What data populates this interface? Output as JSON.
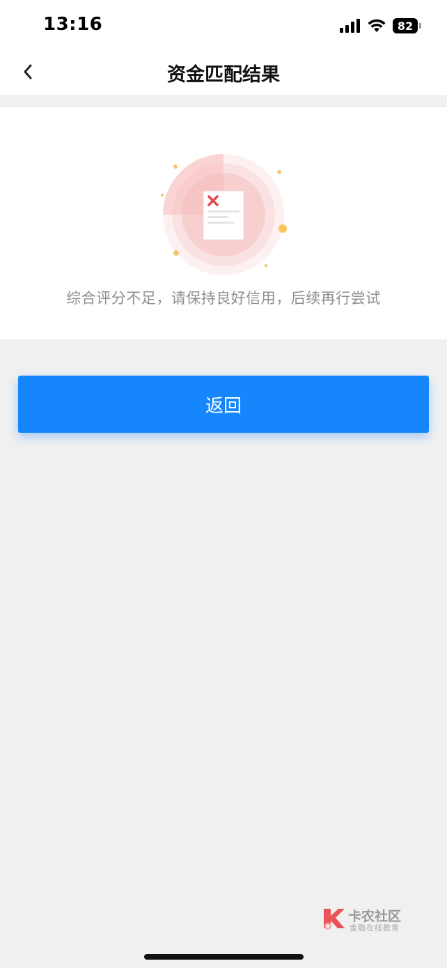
{
  "status_bar": {
    "time": "13:16",
    "battery": "82",
    "icons": [
      "cellular-signal-icon",
      "wifi-icon",
      "battery-icon"
    ]
  },
  "header": {
    "title": "资金匹配结果",
    "back_icon": "chevron-left-icon"
  },
  "result": {
    "illustration_icon": "document-rejected-icon",
    "message": "综合评分不足，请保持良好信用，后续再行尝试"
  },
  "actions": {
    "return_label": "返回"
  },
  "watermark": {
    "name": "卡农社区",
    "subtitle": "金融在线教育"
  },
  "colors": {
    "primary": "#1686fd",
    "page_bg": "#f0f0f0",
    "card_bg": "#ffffff",
    "message_text": "#8f8f8f",
    "error_red": "#e2474c"
  }
}
